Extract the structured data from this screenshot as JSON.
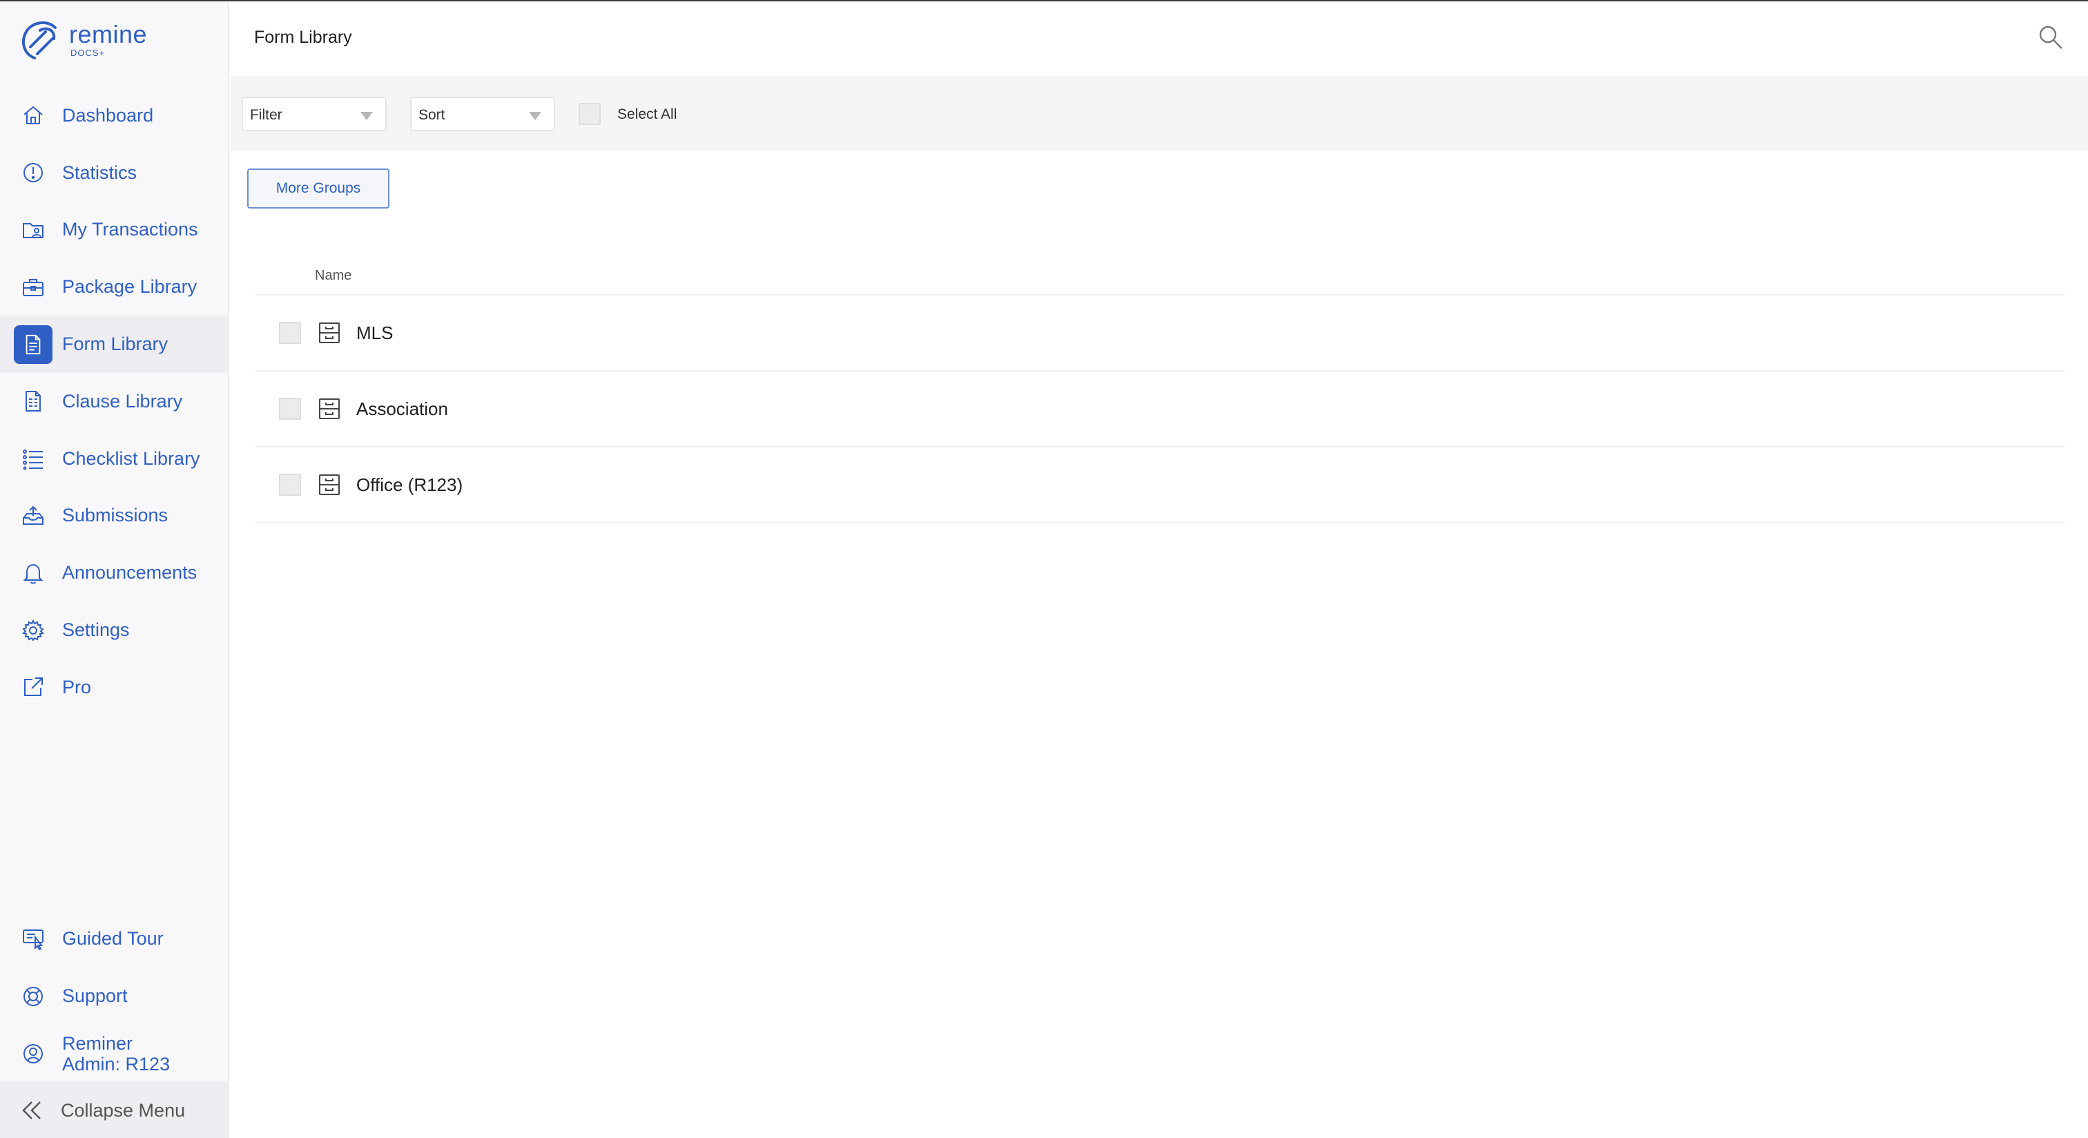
{
  "brand": {
    "name": "remine",
    "sub": "DOCS+",
    "accent": "#2f5fc4"
  },
  "sidebar": {
    "items": [
      {
        "label": "Dashboard",
        "icon": "home-icon"
      },
      {
        "label": "Statistics",
        "icon": "alert-circle-icon"
      },
      {
        "label": "My Transactions",
        "icon": "folder-user-icon"
      },
      {
        "label": "Package Library",
        "icon": "briefcase-icon"
      },
      {
        "label": "Form Library",
        "icon": "document-icon",
        "active": true
      },
      {
        "label": "Clause Library",
        "icon": "clause-document-icon"
      },
      {
        "label": "Checklist Library",
        "icon": "checklist-icon"
      },
      {
        "label": "Submissions",
        "icon": "inbox-upload-icon"
      },
      {
        "label": "Announcements",
        "icon": "bell-icon"
      },
      {
        "label": "Settings",
        "icon": "gear-icon"
      },
      {
        "label": "Pro",
        "icon": "external-link-icon"
      }
    ],
    "bottom": [
      {
        "label": "Guided Tour",
        "icon": "guided-tour-icon"
      },
      {
        "label": "Support",
        "icon": "lifebuoy-icon"
      },
      {
        "label_line1": "Reminer",
        "label_line2": "Admin: R123",
        "icon": "user-circle-icon"
      }
    ],
    "collapse_label": "Collapse Menu"
  },
  "header": {
    "title": "Form Library"
  },
  "toolbar": {
    "filter_label": "Filter",
    "sort_label": "Sort",
    "select_all_label": "Select All"
  },
  "more_groups_label": "More Groups",
  "table": {
    "column_name": "Name",
    "rows": [
      {
        "name": "MLS"
      },
      {
        "name": "Association"
      },
      {
        "name": "Office (R123)"
      }
    ]
  }
}
